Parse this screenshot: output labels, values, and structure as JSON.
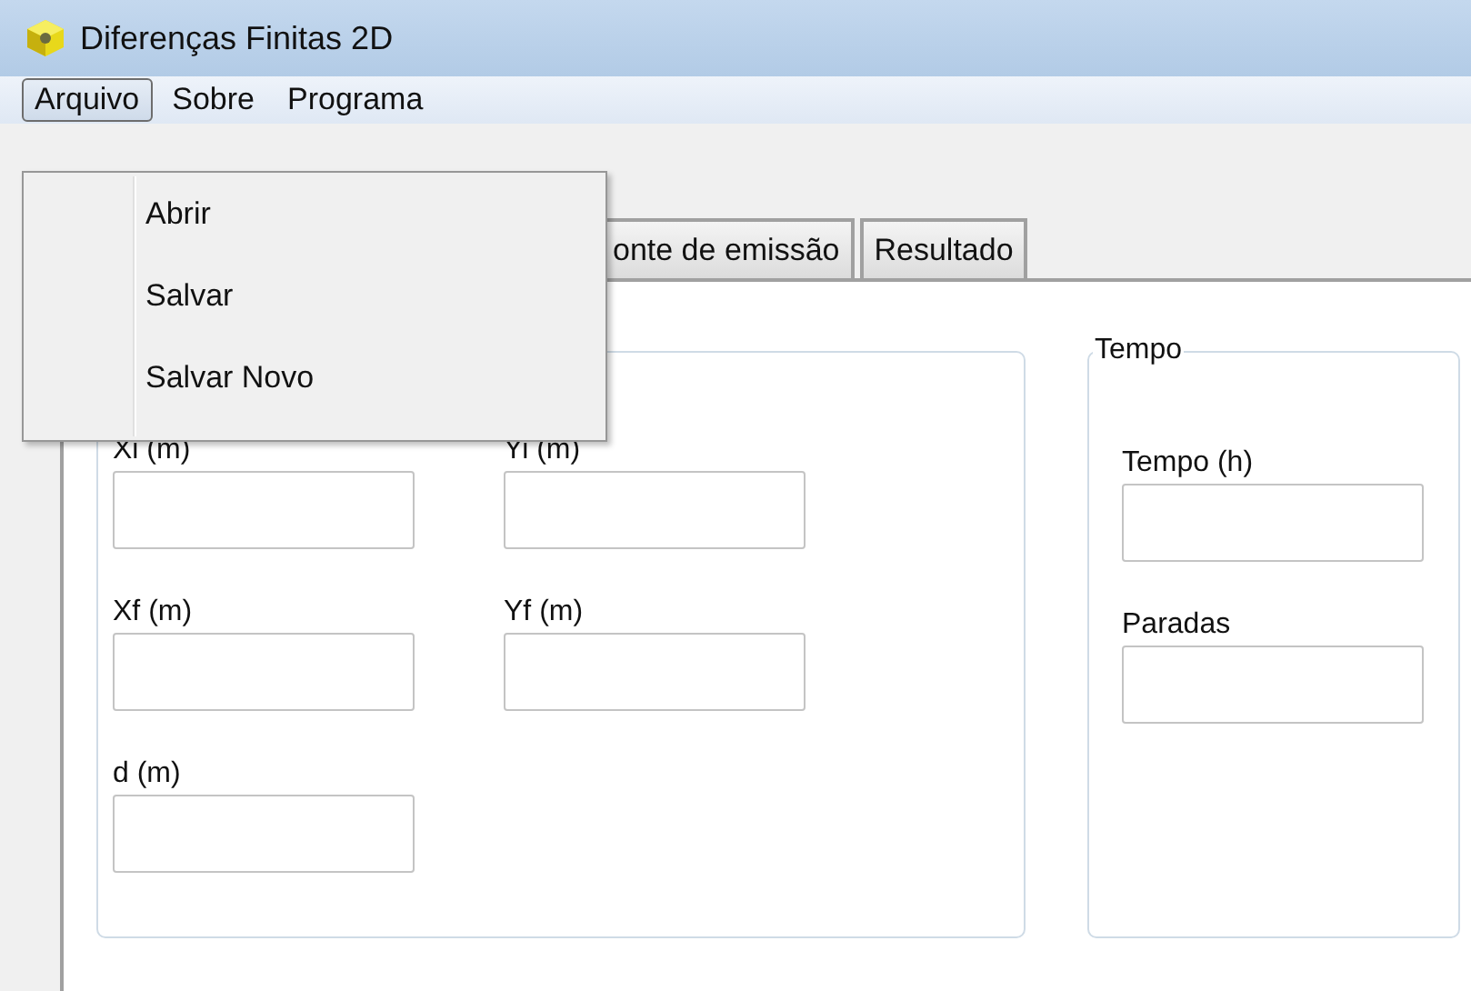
{
  "window": {
    "title": "Diferenças Finitas 2D"
  },
  "menubar": [
    {
      "label": "Arquivo",
      "selected": true
    },
    {
      "label": "Sobre",
      "selected": false
    },
    {
      "label": "Programa",
      "selected": false
    }
  ],
  "open_menu": {
    "items": [
      "Abrir",
      "Salvar",
      "Salvar Novo"
    ]
  },
  "tabs": [
    {
      "label": "onte de emissão",
      "selected": false
    },
    {
      "label": "Resultado",
      "selected": false
    }
  ],
  "groups": [
    {
      "fields": [
        {
          "label": "Xi (m)"
        },
        {
          "label": "Yi (m)"
        },
        {
          "label": "Xf (m)"
        },
        {
          "label": "Yf (m)"
        },
        {
          "label": "d (m)"
        }
      ]
    },
    {
      "title": "Tempo",
      "fields": [
        {
          "label": "Tempo (h)"
        },
        {
          "label": "Paradas"
        }
      ]
    }
  ]
}
